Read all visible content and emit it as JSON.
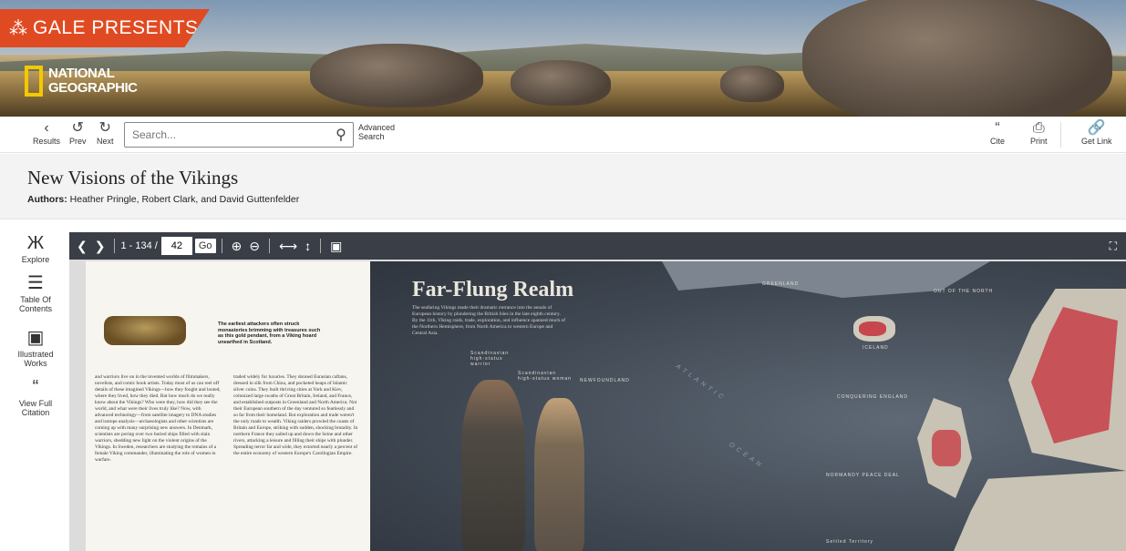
{
  "brand": {
    "tag": "GALE PRESENTS",
    "logo_line1": "NATIONAL",
    "logo_line2": "GEOGRAPHIC"
  },
  "toolbar": {
    "results_label": "Results",
    "prev_label": "Prev",
    "next_label": "Next",
    "search_placeholder": "Search...",
    "advanced_line1": "Advanced",
    "advanced_line2": "Search",
    "cite_label": "Cite",
    "print_label": "Print",
    "getlink_label": "Get Link"
  },
  "document": {
    "title": "New Visions of the Vikings",
    "authors_label": "Authors:",
    "authors": "Heather Pringle, Robert Clark, and David Guttenfelder"
  },
  "sidebar": {
    "items": [
      {
        "label": "Explore",
        "icon": "binoculars-icon"
      },
      {
        "label": "Table Of Contents",
        "icon": "list-icon"
      },
      {
        "label": "Illustrated Works",
        "icon": "image-icon"
      },
      {
        "label": "View Full Citation",
        "icon": "quote-icon"
      }
    ]
  },
  "viewer": {
    "page_range": "1 - 134 /",
    "current_page": "42",
    "go_label": "Go"
  },
  "page_left": {
    "caption": "The earliest attackers often struck monasteries brimming with treasures such as this gold pendant, from a Viking hoard unearthed in Scotland.",
    "col1": "and warriors live on in the invented worlds of filmmakers, novelists, and comic book artists. Today most of us can reel off details of these imagined Vikings—how they fought and looted, where they lived, how they died. But how much do we really know about the Vikings? Who were they, how did they see the world, and what were their lives truly like? Now, with advanced technology—from satellite imagery to DNA studies and isotope analysis—archaeologists and other scientists are coming up with many surprising new answers. In Denmark, scientists are poring over two buried ships filled with slain warriors, shedding new light on the violent origins of the Vikings. In Sweden, researchers are studying the remains of a female Viking commander, illuminating the role of women in warfare.",
    "col2": "traded widely for luxuries. They donned Eurasian caftans, dressed in silk from China, and pocketed heaps of Islamic silver coins. They built thriving cities at York and Kiev, colonized large swaths of Great Britain, Ireland, and France, and established outposts in Greenland and North America. Not their European southern of the day ventured so fearlessly and so far from their homeland. But exploration and trade weren't the only roads to wealth. Viking raiders prowled the coasts of Britain and Europe, striking with sudden, shocking brutality. In northern France they sailed up and down the Seine and other rivers, attacking a leisure and filling their ships with plunder. Spreading terror far and wide, they extorted nearly a percent of the entire economy of western Europe's Carolingian Empire."
  },
  "page_right": {
    "title": "Far-Flung Realm",
    "intro": "The seafaring Vikings made their dramatic entrance into the annals of European history by plundering the British Isles in the late eighth century. By the 11th, Viking raids, trade, exploration, and influence spanned much of the Northern Hemisphere, from North America to western Europe and Central Asia.",
    "label_greenland": "GREENLAND",
    "label_iceland": "ICELAND",
    "label_newfoundland": "NEWFOUNDLAND",
    "label_atlantic": "ATLANTIC",
    "label_ocean": "OCEAN",
    "label_out_north": "OUT OF THE NORTH",
    "label_conquering": "CONQUERING ENGLAND",
    "label_normandy": "NORMANDY PEACE DEAL",
    "label_settled": "Settled Territory",
    "label_warrior": "Scandinavian high-status warrior",
    "label_woman": "Scandinavian high-status woman"
  },
  "colors": {
    "gale_orange": "#e04a22",
    "natgeo_yellow": "#f5c800",
    "viewer_bar": "#3a3f47",
    "viking_highlight": "#6fd14d",
    "territory_red": "#c7464e"
  }
}
